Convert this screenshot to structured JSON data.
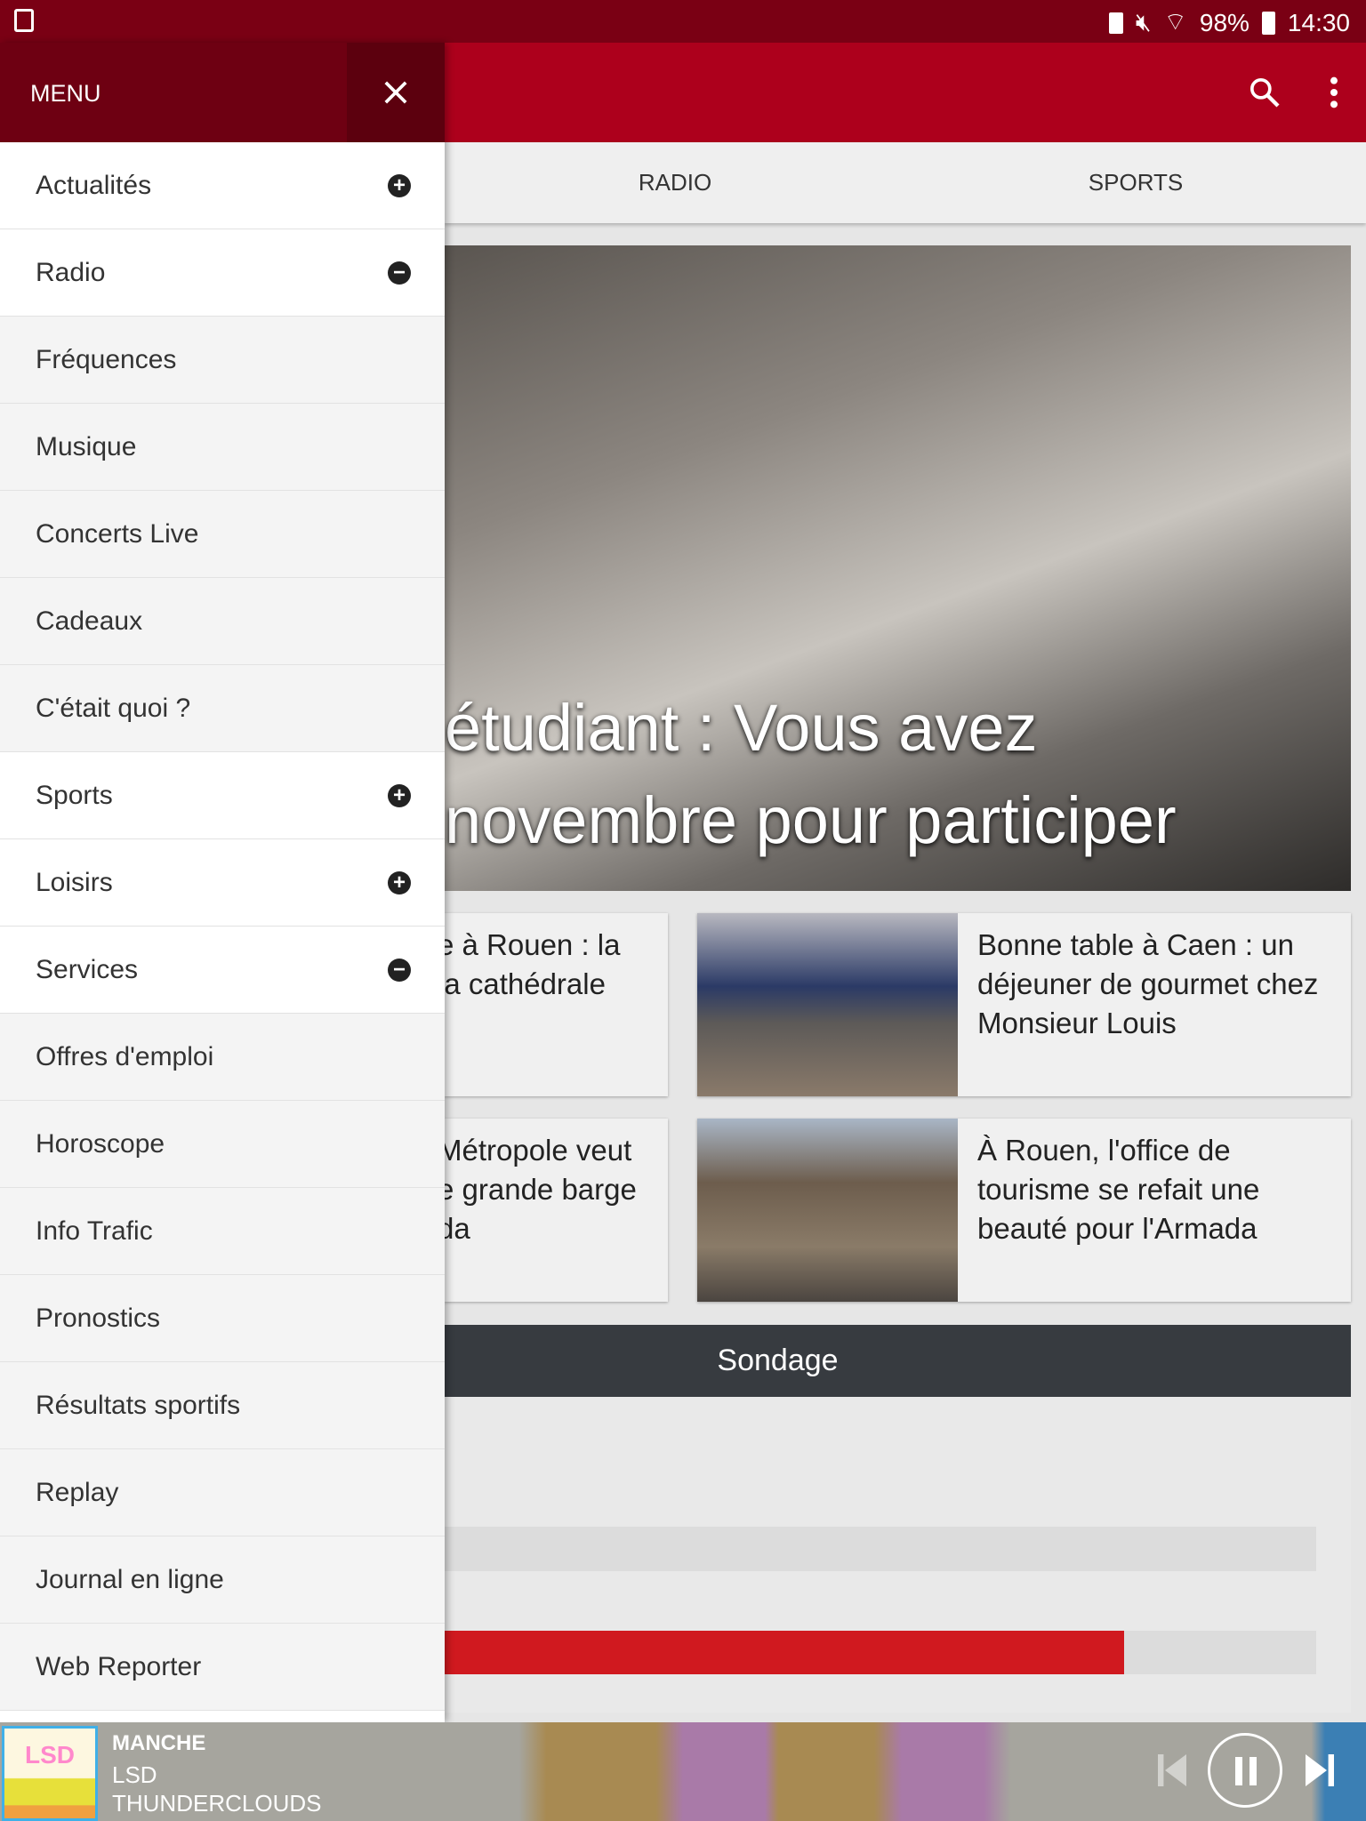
{
  "status": {
    "battery": "98%",
    "time": "14:30",
    "icons": [
      "screenshot-icon",
      "battery-saver-icon",
      "mute-icon",
      "wifi-icon",
      "battery-charging-icon"
    ]
  },
  "appbar": {
    "icons": [
      "search-icon",
      "more-vert-icon"
    ]
  },
  "tabs": [
    "RADIO",
    "SPORTS"
  ],
  "hero": {
    "line1": "étudiant : Vous avez",
    "line2": "novembre pour participer"
  },
  "cards": [
    {
      "text": "e à Rouen : la\nla cathédrale"
    },
    {
      "text": "Bonne table à Caen : un\ndéjeuner de gourmet chez\nMonsieur Louis"
    },
    {
      "text": "Métropole veut\ne grande barge\nda"
    },
    {
      "text": "À Rouen, l'office de\ntourisme se refait une\nbeauté pour l'Armada"
    }
  ],
  "poll": {
    "title": "Sondage",
    "results": [
      0,
      0.78
    ]
  },
  "drawer": {
    "title": "MENU",
    "items": [
      {
        "label": "Actualités",
        "icon": "plus"
      },
      {
        "label": "Radio",
        "icon": "minus"
      },
      {
        "label": "Fréquences",
        "sub": true
      },
      {
        "label": "Musique",
        "sub": true
      },
      {
        "label": "Concerts Live",
        "sub": true
      },
      {
        "label": "Cadeaux",
        "sub": true
      },
      {
        "label": "C'était quoi ?",
        "sub": true
      },
      {
        "label": "Sports",
        "icon": "plus"
      },
      {
        "label": "Loisirs",
        "icon": "plus"
      },
      {
        "label": "Services",
        "icon": "minus"
      },
      {
        "label": "Offres d'emploi",
        "sub": true
      },
      {
        "label": "Horoscope",
        "sub": true
      },
      {
        "label": "Info Trafic",
        "sub": true
      },
      {
        "label": "Pronostics",
        "sub": true
      },
      {
        "label": "Résultats sportifs",
        "sub": true
      },
      {
        "label": "Replay",
        "sub": true
      },
      {
        "label": "Journal en ligne",
        "sub": true
      },
      {
        "label": "Web Reporter",
        "sub": true
      }
    ]
  },
  "player": {
    "station": "MANCHE",
    "artist": "LSD",
    "track": "THUNDERCLOUDS",
    "album_art_text": "LSD",
    "accent": "#d0191f"
  }
}
